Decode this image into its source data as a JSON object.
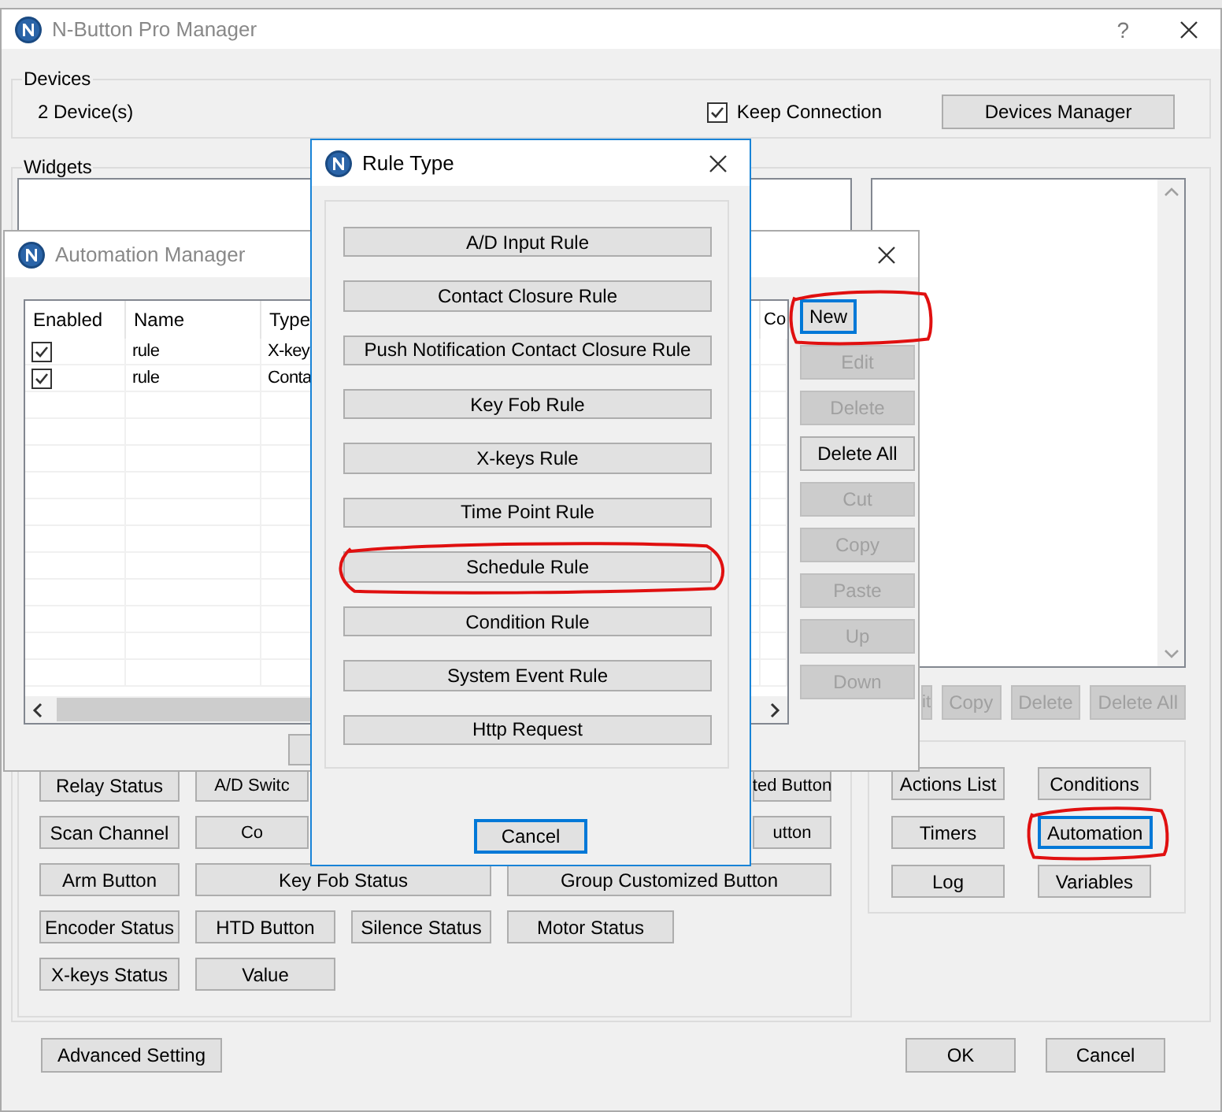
{
  "main_window": {
    "title": "N-Button Pro Manager",
    "active": false,
    "help": "?",
    "devices": {
      "label": "Devices",
      "count": "2 Device(s)",
      "keep_connection": {
        "label": "Keep Connection",
        "checked": true
      },
      "manager_button": "Devices Manager"
    },
    "widgets": {
      "label": "Widgets",
      "rows": [
        [
          {
            "label": "Relay Status"
          },
          {
            "label": "A/D Switc"
          },
          {
            "label": "ted Button"
          }
        ],
        [
          {
            "label": "Scan Channel"
          },
          {
            "label": "Co"
          },
          {
            "label": "utton"
          }
        ],
        [
          {
            "label": "Arm Button"
          },
          {
            "label": "Key Fob Status"
          },
          {
            "label": "Group Customized Button"
          }
        ],
        [
          {
            "label": "Encoder Status"
          },
          {
            "label": "HTD Button"
          },
          {
            "label": "Silence Status"
          },
          {
            "label": "Motor Status"
          }
        ],
        [
          {
            "label": "X-keys Status"
          },
          {
            "label": "Value"
          }
        ]
      ],
      "list_buttons": [
        {
          "label": "it",
          "disabled": true
        },
        {
          "label": "Copy",
          "disabled": true
        },
        {
          "label": "Delete",
          "disabled": true
        },
        {
          "label": "Delete All",
          "disabled": true
        }
      ],
      "tools": [
        {
          "label": "Actions List",
          "focused": false,
          "circled": false
        },
        {
          "label": "Conditions",
          "focused": false,
          "circled": false
        },
        {
          "label": "Timers",
          "focused": false,
          "circled": false
        },
        {
          "label": "Automation",
          "focused": true,
          "circled": true
        },
        {
          "label": "Log",
          "focused": false,
          "circled": false
        },
        {
          "label": "Variables",
          "focused": false,
          "circled": false
        }
      ]
    },
    "footer": {
      "advanced": "Advanced Setting",
      "ok": "OK",
      "cancel": "Cancel"
    }
  },
  "automation_manager": {
    "title": "Automation Manager",
    "active": false,
    "table": {
      "columns": [
        "Enabled",
        "Name",
        "Type",
        "Co"
      ],
      "rows": [
        {
          "enabled": true,
          "name": "rule",
          "type": "X-key"
        },
        {
          "enabled": true,
          "name": "rule",
          "type": "Conta"
        }
      ]
    },
    "buttons": [
      {
        "label": "New",
        "disabled": false,
        "focused": true,
        "circled": true
      },
      {
        "label": "Edit",
        "disabled": true,
        "focused": false,
        "circled": false
      },
      {
        "label": "Delete",
        "disabled": true,
        "focused": false,
        "circled": false
      },
      {
        "label": "Delete All",
        "disabled": false,
        "focused": false,
        "circled": false
      },
      {
        "label": "Cut",
        "disabled": true,
        "focused": false,
        "circled": false
      },
      {
        "label": "Copy",
        "disabled": true,
        "focused": false,
        "circled": false
      },
      {
        "label": "Paste",
        "disabled": true,
        "focused": false,
        "circled": false
      },
      {
        "label": "Up",
        "disabled": true,
        "focused": false,
        "circled": false
      },
      {
        "label": "Down",
        "disabled": true,
        "focused": false,
        "circled": false
      }
    ]
  },
  "rule_type": {
    "title": "Rule Type",
    "active": true,
    "options": [
      {
        "label": "A/D Input Rule",
        "circled": false
      },
      {
        "label": "Contact Closure Rule",
        "circled": false
      },
      {
        "label": "Push Notification Contact Closure Rule",
        "circled": false
      },
      {
        "label": "Key Fob Rule",
        "circled": false
      },
      {
        "label": "X-keys Rule",
        "circled": false
      },
      {
        "label": "Time Point Rule",
        "circled": false
      },
      {
        "label": "Schedule Rule",
        "circled": true
      },
      {
        "label": "Condition Rule",
        "circled": false
      },
      {
        "label": "System Event Rule",
        "circled": false
      },
      {
        "label": "Http Request",
        "circled": false
      }
    ],
    "cancel": {
      "label": "Cancel",
      "focused": true
    }
  }
}
